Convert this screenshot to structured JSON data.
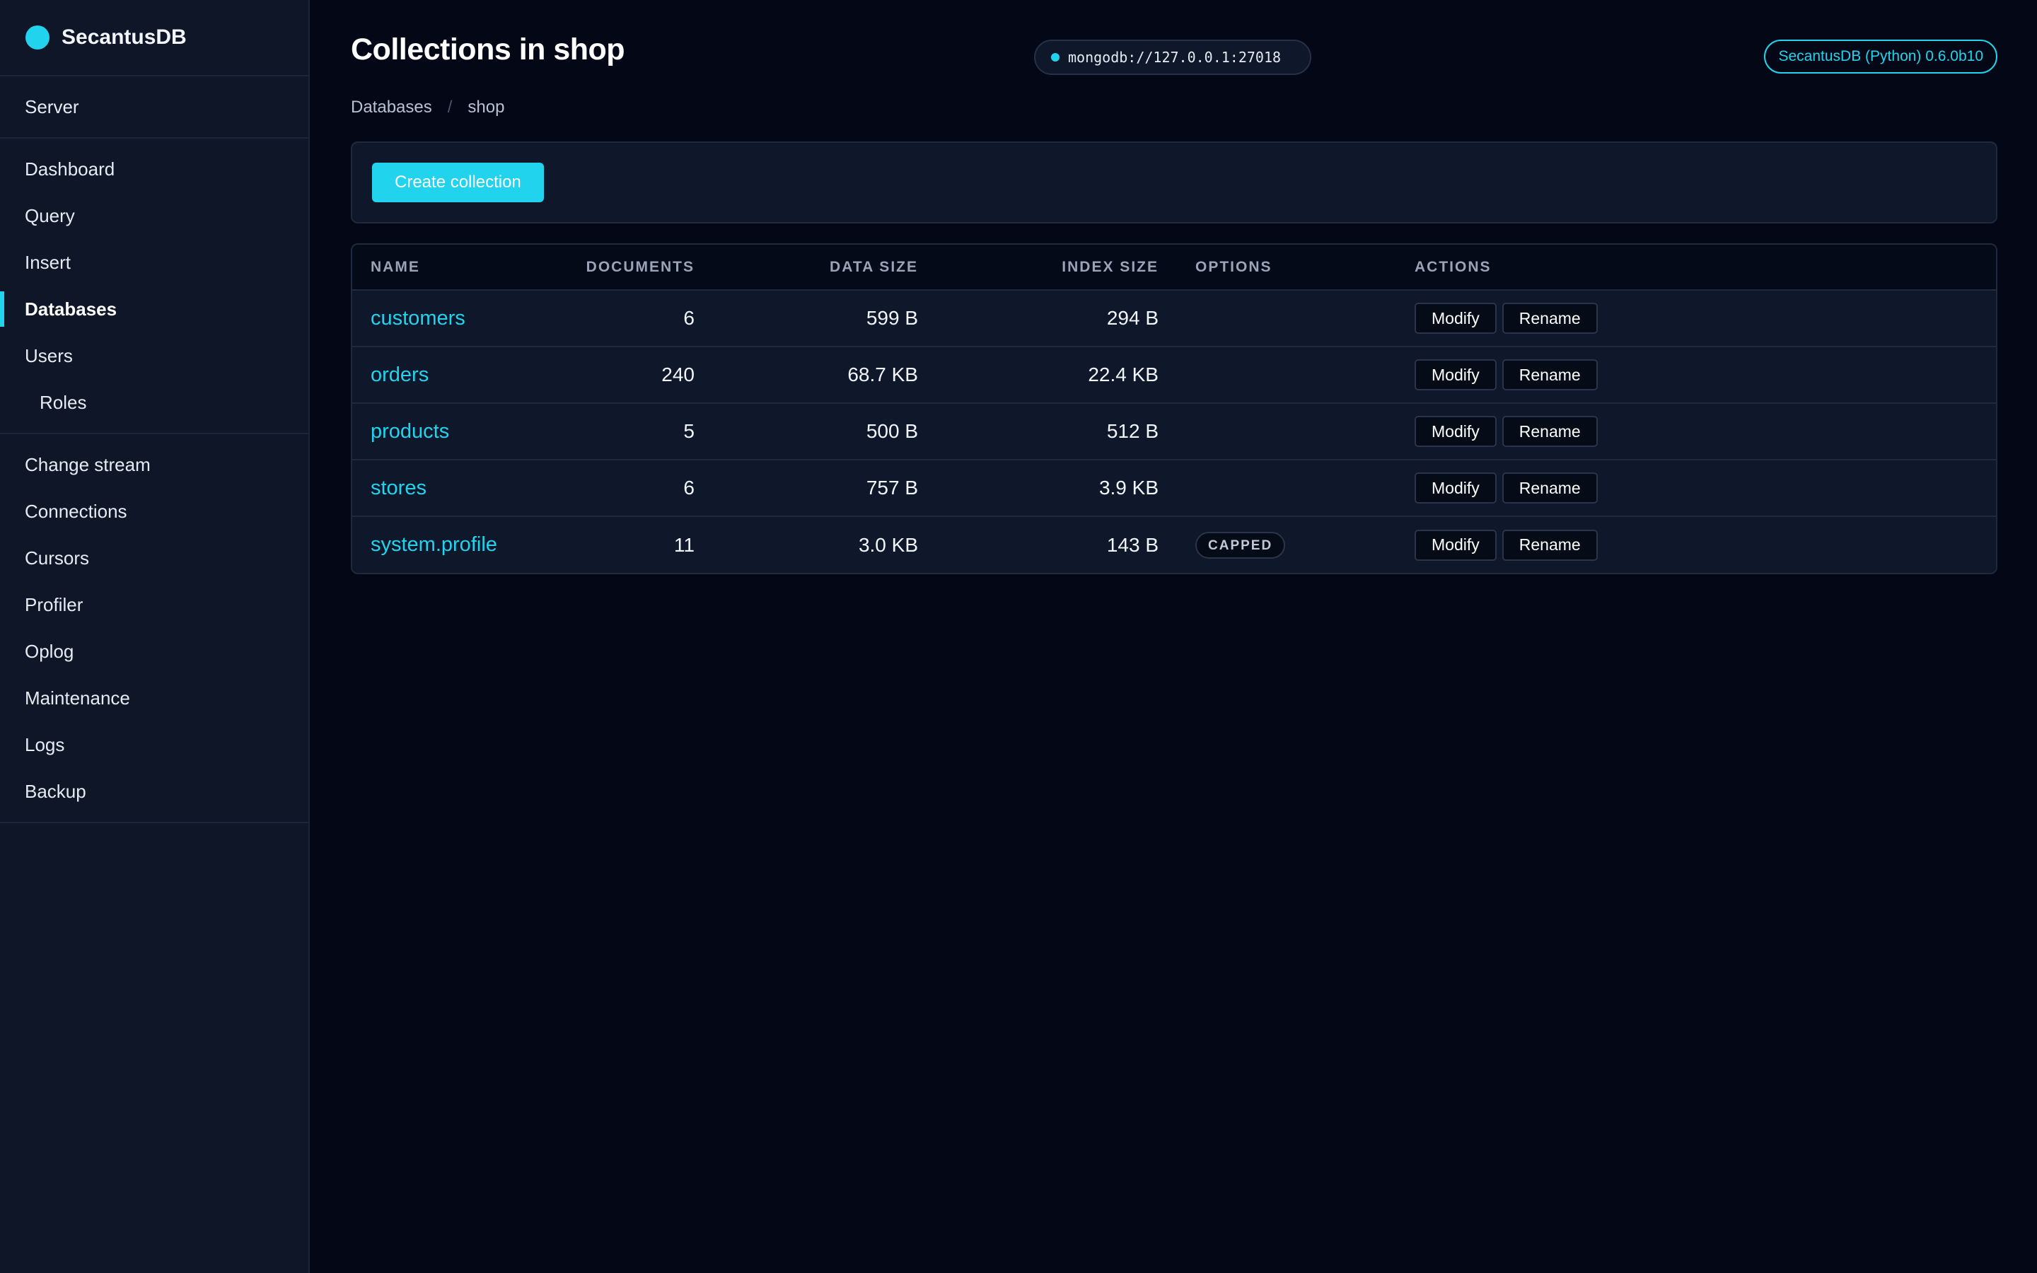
{
  "brand": {
    "name": "SecantusDB"
  },
  "nav": {
    "groups": [
      {
        "items": [
          {
            "label": "Server",
            "active": false,
            "sub": false
          }
        ]
      },
      {
        "items": [
          {
            "label": "Dashboard",
            "active": false,
            "sub": false
          },
          {
            "label": "Query",
            "active": false,
            "sub": false
          },
          {
            "label": "Insert",
            "active": false,
            "sub": false
          },
          {
            "label": "Databases",
            "active": true,
            "sub": false
          },
          {
            "label": "Users",
            "active": false,
            "sub": false
          },
          {
            "label": "Roles",
            "active": false,
            "sub": true
          }
        ]
      },
      {
        "items": [
          {
            "label": "Change stream",
            "active": false,
            "sub": false
          },
          {
            "label": "Connections",
            "active": false,
            "sub": false
          },
          {
            "label": "Cursors",
            "active": false,
            "sub": false
          },
          {
            "label": "Profiler",
            "active": false,
            "sub": false
          },
          {
            "label": "Oplog",
            "active": false,
            "sub": false
          },
          {
            "label": "Maintenance",
            "active": false,
            "sub": false
          },
          {
            "label": "Logs",
            "active": false,
            "sub": false
          },
          {
            "label": "Backup",
            "active": false,
            "sub": false
          }
        ]
      }
    ]
  },
  "header": {
    "title": "Collections in shop",
    "connection": "mongodb://127.0.0.1:27018",
    "version": "SecantusDB (Python) 0.6.0b10"
  },
  "breadcrumb": {
    "root": "Databases",
    "separator": "/",
    "current": "shop"
  },
  "toolbar": {
    "create_label": "Create collection"
  },
  "table": {
    "headers": {
      "name": "NAME",
      "documents": "DOCUMENTS",
      "data_size": "DATA SIZE",
      "index_size": "INDEX SIZE",
      "options": "OPTIONS",
      "actions": "ACTIONS"
    },
    "modify_label": "Modify",
    "rename_label": "Rename",
    "rows": [
      {
        "name": "customers",
        "documents": "6",
        "data_size": "599 B",
        "index_size": "294 B",
        "options": ""
      },
      {
        "name": "orders",
        "documents": "240",
        "data_size": "68.7 KB",
        "index_size": "22.4 KB",
        "options": ""
      },
      {
        "name": "products",
        "documents": "5",
        "data_size": "500 B",
        "index_size": "512 B",
        "options": ""
      },
      {
        "name": "stores",
        "documents": "6",
        "data_size": "757 B",
        "index_size": "3.9 KB",
        "options": ""
      },
      {
        "name": "system.profile",
        "documents": "11",
        "data_size": "3.0 KB",
        "index_size": "143 B",
        "options": "CAPPED"
      }
    ]
  },
  "colors": {
    "accent": "#22d3ee",
    "background": "#040816",
    "sidebar": "#0e1628",
    "panel": "#0f172a"
  }
}
